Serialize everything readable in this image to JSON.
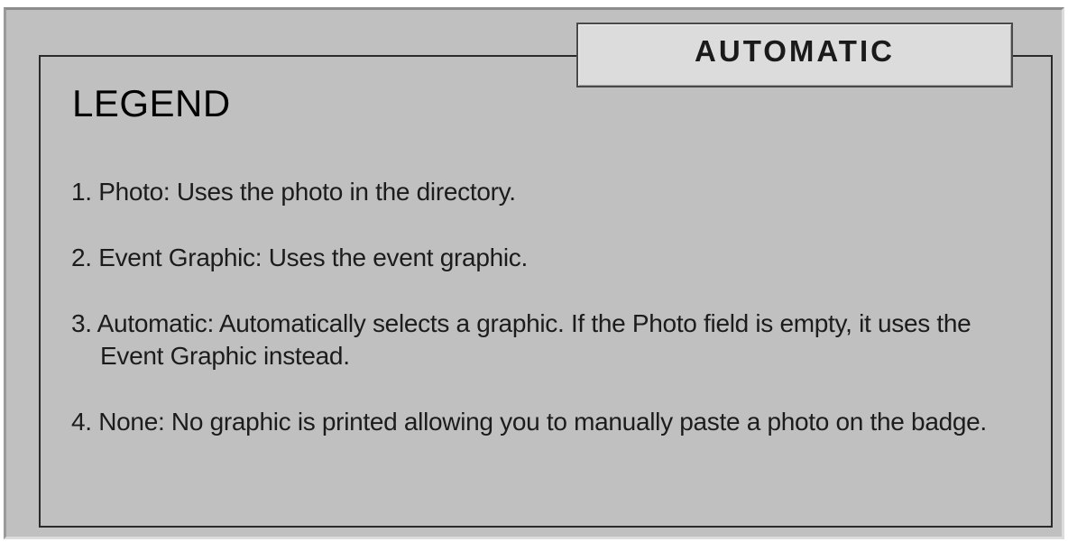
{
  "mode_tab": {
    "label": "AUTOMATIC"
  },
  "legend": {
    "title": "LEGEND",
    "items": [
      {
        "text": "1. Photo: Uses the photo in the directory."
      },
      {
        "text": "2. Event Graphic: Uses the event graphic."
      },
      {
        "text": "3. Automatic: Automatically selects a graphic. If the Photo field is empty, it uses the Event Graphic instead."
      },
      {
        "text": "4. None: No graphic is printed allowing you to manually paste a photo on the badge."
      }
    ]
  }
}
